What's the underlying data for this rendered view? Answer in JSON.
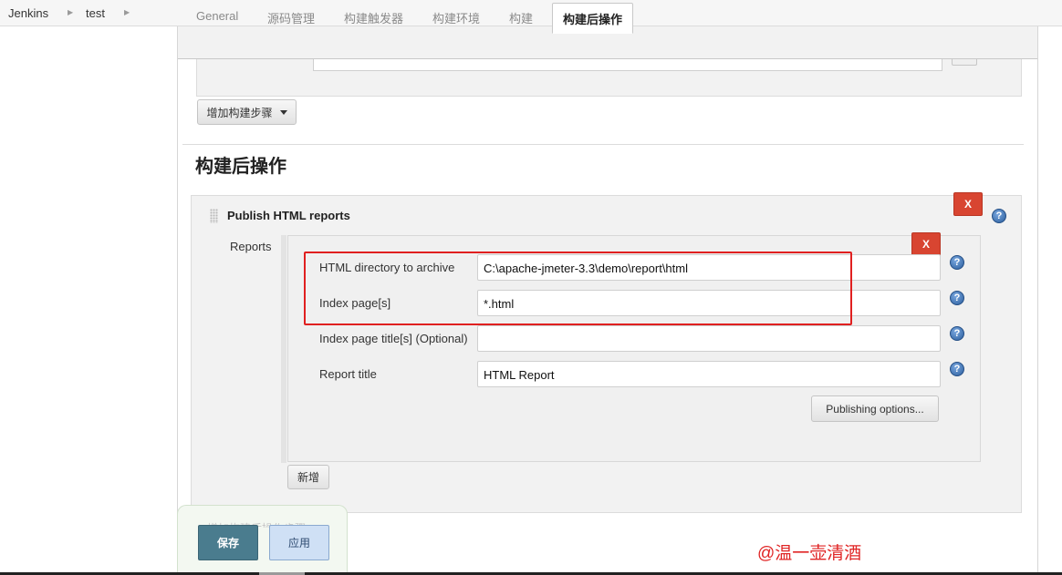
{
  "breadcrumb": {
    "items": [
      "Jenkins",
      "test"
    ]
  },
  "tabs": [
    {
      "label": "General",
      "active": false
    },
    {
      "label": "源码管理",
      "active": false
    },
    {
      "label": "构建触发器",
      "active": false
    },
    {
      "label": "构建环境",
      "active": false
    },
    {
      "label": "构建",
      "active": false
    },
    {
      "label": "构建后操作",
      "active": true
    }
  ],
  "build": {
    "add_step_label": "增加构建步骤"
  },
  "post_build": {
    "heading": "构建后操作",
    "publisher": {
      "title": "Publish HTML reports",
      "delete_label": "X",
      "reports_label": "Reports",
      "report": {
        "delete_label": "X",
        "fields": [
          {
            "label": "HTML directory to archive",
            "value": "C:\\apache-jmeter-3.3\\demo\\report\\html"
          },
          {
            "label": "Index page[s]",
            "value": "*.html"
          },
          {
            "label": "Index page title[s] (Optional)",
            "value": ""
          },
          {
            "label": "Report title",
            "value": "HTML Report"
          }
        ],
        "publishing_options_label": "Publishing options..."
      },
      "add_label": "新增"
    }
  },
  "help_icon_glyph": "?",
  "footer": {
    "ghost_label": "增加构建后操作步骤",
    "save_label": "保存",
    "apply_label": "应用"
  },
  "watermark": "@温一壶清酒",
  "colors": {
    "delete": "#d84531",
    "save": "#4a7c8e",
    "apply": "#cfe0f5",
    "highlight": "#e02020",
    "help": "#2b5d9c"
  }
}
